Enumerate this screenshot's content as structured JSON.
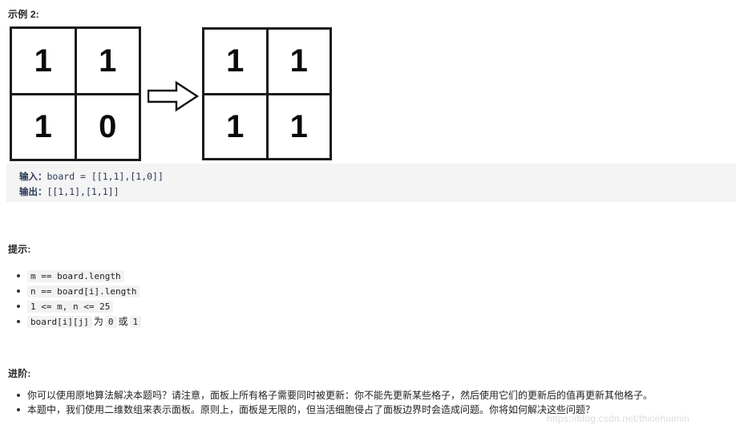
{
  "example": {
    "title": "示例 2:",
    "input_grid": {
      "rows": 2,
      "cols": 2,
      "cells": [
        "1",
        "1",
        "1",
        "0"
      ]
    },
    "output_grid": {
      "rows": 2,
      "cols": 2,
      "cells": [
        "1",
        "1",
        "1",
        "1"
      ]
    },
    "arrow_icon": "right-arrow-outline-icon",
    "code": {
      "input_label": "输入：",
      "input_value": "board = [[1,1],[1,0]]",
      "output_label": "输出：",
      "output_value": "[[1,1],[1,1]]"
    }
  },
  "hints": {
    "title": "提示:",
    "items": [
      {
        "code": "m == board.length"
      },
      {
        "code": "n == board[i].length"
      },
      {
        "code": "1 <= m, n <= 25"
      },
      {
        "code": "board[i][j]",
        "mid1": "为",
        "code2": "0",
        "mid2": "或",
        "code3": "1"
      }
    ]
  },
  "advanced": {
    "title": "进阶:",
    "items": [
      "你可以使用原地算法解决本题吗？请注意，面板上所有格子需要同时被更新：你不能先更新某些格子，然后使用它们的更新后的值再更新其他格子。",
      "本题中，我们使用二维数组来表示面板。原则上，面板是无限的，但当活细胞侵占了面板边界时会造成问题。你将如何解决这些问题？"
    ]
  },
  "watermark": {
    "text": "https://blog.csdn.net/thxiehuimin"
  },
  "colors": {
    "code_block_bg": "#f4f4f4",
    "inline_code_bg": "#f2f2f2",
    "code_text": "#2b3a55",
    "grid_line": "#1b1b1b",
    "watermark": "#dcdcdc"
  }
}
